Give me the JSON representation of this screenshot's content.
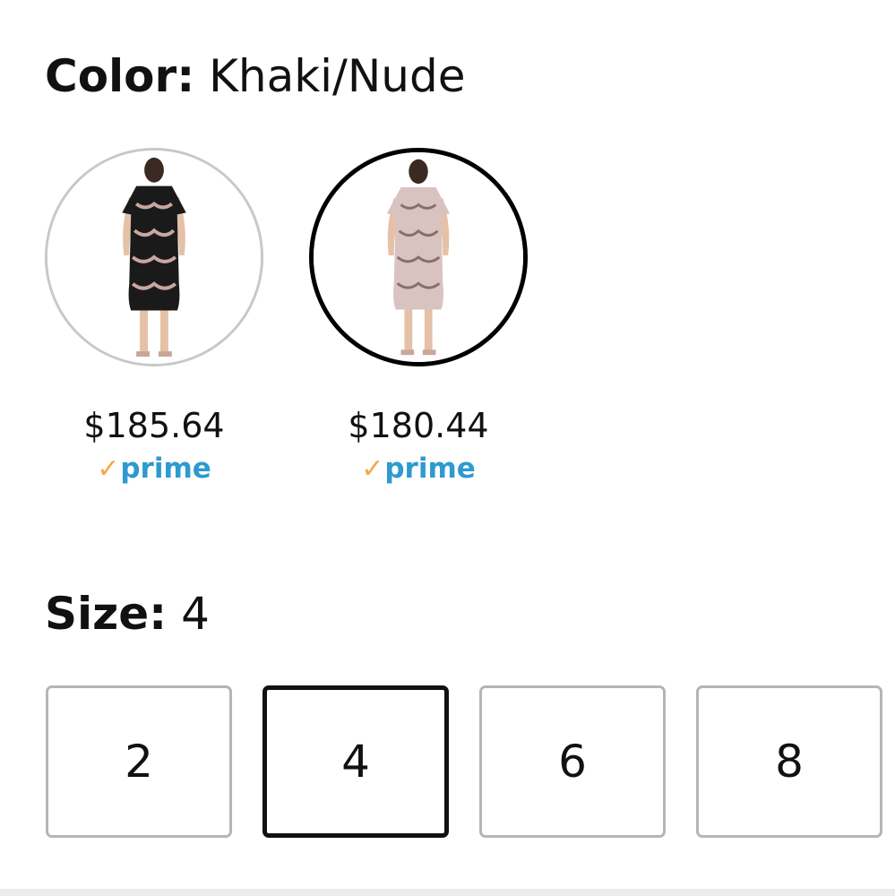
{
  "color": {
    "label": "Color:",
    "selected": "Khaki/Nude",
    "options": [
      {
        "price": "$185.64",
        "prime": "prime",
        "selected": false,
        "dress_color": "#1a1a1a",
        "pattern_color": "#c9a6a0"
      },
      {
        "price": "$180.44",
        "prime": "prime",
        "selected": true,
        "dress_color": "#d9c3c0",
        "pattern_color": "#8a6d6a"
      }
    ]
  },
  "size": {
    "label": "Size:",
    "selected": "4",
    "options": [
      "2",
      "4",
      "6",
      "8"
    ]
  },
  "colors": {
    "prime_blue": "#2d9ad0",
    "prime_check": "#f3a847",
    "selected_border": "#111111",
    "unselected_border": "#b5b5b5"
  },
  "icons": {
    "prime_check": "checkmark-icon"
  }
}
